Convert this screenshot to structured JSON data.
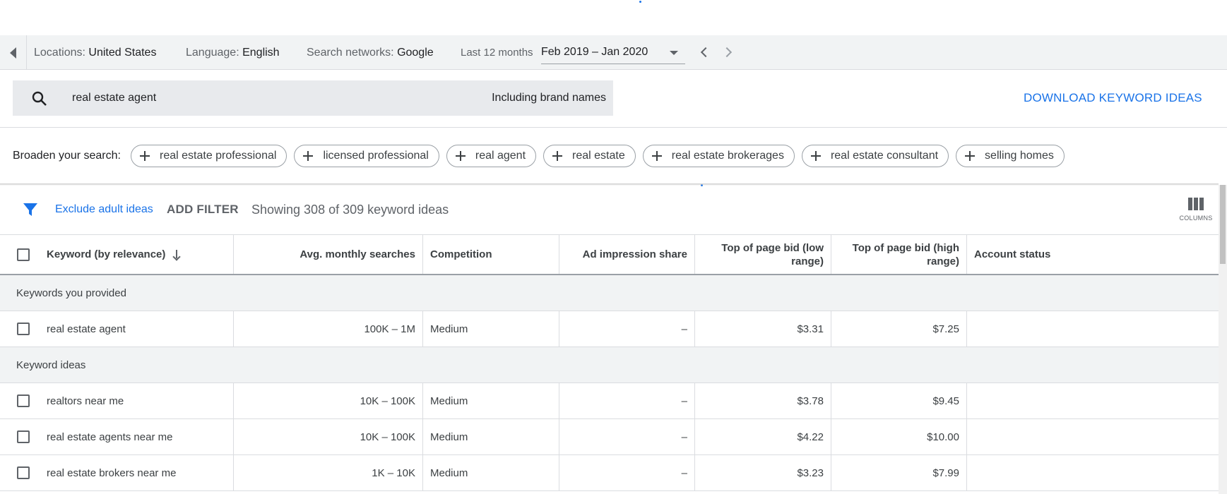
{
  "topbar": {
    "locations_label": "Locations:",
    "locations_value": "United States",
    "language_label": "Language:",
    "language_value": "English",
    "networks_label": "Search networks:",
    "networks_value": "Google",
    "range_label": "Last 12 months",
    "range_value": "Feb 2019 – Jan 2020"
  },
  "search": {
    "query": "real estate agent",
    "brand_toggle": "Including brand names",
    "download_label": "DOWNLOAD KEYWORD IDEAS"
  },
  "broaden": {
    "label": "Broaden your search:",
    "chips": [
      "real estate professional",
      "licensed professional",
      "real agent",
      "real estate",
      "real estate brokerages",
      "real estate consultant",
      "selling homes"
    ]
  },
  "filters": {
    "exclude_adult": "Exclude adult ideas",
    "add_filter": "ADD FILTER",
    "showing": "Showing 308 of 309 keyword ideas",
    "columns_label": "COLUMNS"
  },
  "table": {
    "headers": {
      "keyword": "Keyword (by relevance)",
      "avg": "Avg. monthly searches",
      "competition": "Competition",
      "ad_share": "Ad impression share",
      "low_bid_line1": "Top of page bid (low",
      "low_bid_line2": "range)",
      "high_bid_line1": "Top of page bid (high",
      "high_bid_line2": "range)",
      "account": "Account status"
    },
    "groups": {
      "provided": "Keywords you provided",
      "ideas": "Keyword ideas"
    },
    "provided_rows": [
      {
        "keyword": "real estate agent",
        "avg": "100K – 1M",
        "competition": "Medium",
        "ad_share": "–",
        "low": "$3.31",
        "high": "$7.25"
      }
    ],
    "idea_rows": [
      {
        "keyword": "realtors near me",
        "avg": "10K – 100K",
        "competition": "Medium",
        "ad_share": "–",
        "low": "$3.78",
        "high": "$9.45"
      },
      {
        "keyword": "real estate agents near me",
        "avg": "10K – 100K",
        "competition": "Medium",
        "ad_share": "–",
        "low": "$4.22",
        "high": "$10.00"
      },
      {
        "keyword": "real estate brokers near me",
        "avg": "1K – 10K",
        "competition": "Medium",
        "ad_share": "–",
        "low": "$3.23",
        "high": "$7.99"
      }
    ]
  },
  "colors": {
    "accent": "#1a73e8",
    "toolbar_bg": "#f1f3f4",
    "search_bg": "#e8eaed"
  }
}
